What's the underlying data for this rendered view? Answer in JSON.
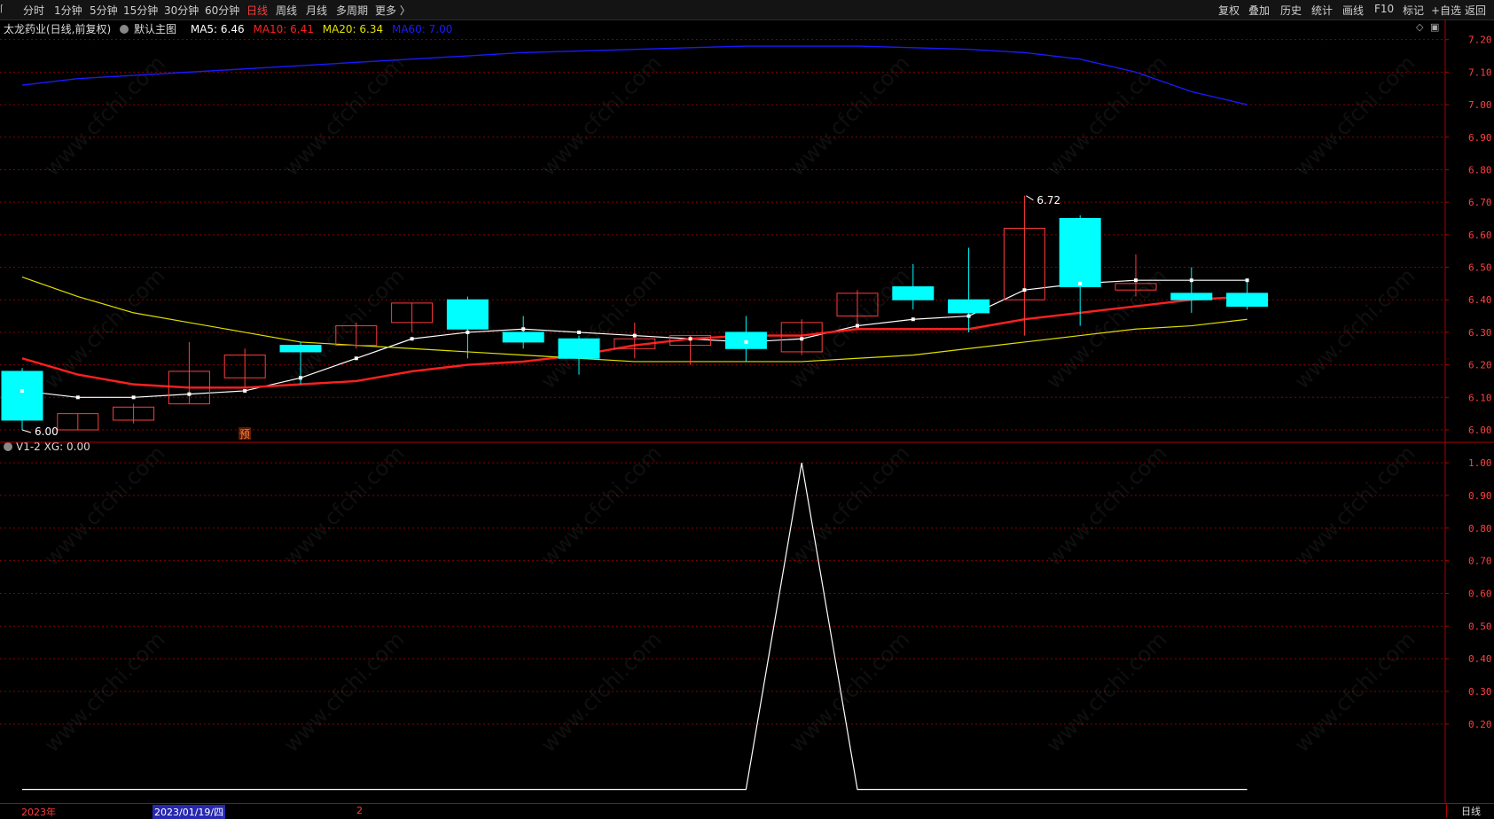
{
  "toolbar": {
    "left_items": [
      "分时",
      "1分钟",
      "5分钟",
      "15分钟",
      "30分钟",
      "60分钟",
      "日线",
      "周线",
      "月线",
      "多周期",
      "更多 〉"
    ],
    "active_item": "日线",
    "right_items": [
      "复权",
      "叠加",
      "历史",
      "统计",
      "画线",
      "F10",
      "标记",
      "+自选",
      "返回"
    ]
  },
  "main_chart": {
    "stock_label": "太龙药业(日线,前复权)",
    "indicator_name": "默认主图",
    "ma5_label": "MA5: 6.46",
    "ma10_label": "MA10: 6.41",
    "ma20_label": "MA20: 6.34",
    "ma60_label": "MA60: 7.00",
    "high_annotation": "6.72",
    "low_annotation": "6.00",
    "forecast_badge": "预",
    "y_ticks": [
      "7.20",
      "7.10",
      "7.00",
      "6.90",
      "6.80",
      "6.70",
      "6.60",
      "6.50",
      "6.40",
      "6.30",
      "6.20",
      "6.10",
      "6.00"
    ]
  },
  "sub_chart": {
    "label": "V1-2  XG: 0.00",
    "y_ticks": [
      "1.00",
      "0.90",
      "0.80",
      "0.70",
      "0.60",
      "0.50",
      "0.40",
      "0.30",
      "0.20"
    ]
  },
  "bottom_bar": {
    "year_label": "2023年",
    "date_label": "2023/01/19/四",
    "month_label": "2",
    "period": "日线"
  },
  "watermark": "www.cfchi.com",
  "colors": {
    "up": "#ff3c3c",
    "down": "#00ffff",
    "ma5": "#ffffff",
    "ma10": "#ff2020",
    "ma20": "#e0e000",
    "ma60": "#1a1aff",
    "grid": "#8a0000"
  },
  "chart_data": [
    {
      "type": "candlestick",
      "title": "太龙药业(日线,前复权)",
      "ylim": [
        6.0,
        7.2
      ],
      "candles": [
        {
          "open": 6.18,
          "close": 6.03,
          "high": 6.19,
          "low": 6.0
        },
        {
          "open": 6.0,
          "close": 6.05,
          "high": 6.05,
          "low": 6.0
        },
        {
          "open": 6.03,
          "close": 6.07,
          "high": 6.08,
          "low": 6.02
        },
        {
          "open": 6.08,
          "close": 6.18,
          "high": 6.27,
          "low": 6.08
        },
        {
          "open": 6.16,
          "close": 6.23,
          "high": 6.25,
          "low": 6.13
        },
        {
          "open": 6.26,
          "close": 6.24,
          "high": 6.27,
          "low": 6.14
        },
        {
          "open": 6.26,
          "close": 6.32,
          "high": 6.33,
          "low": 6.25
        },
        {
          "open": 6.33,
          "close": 6.39,
          "high": 6.39,
          "low": 6.3
        },
        {
          "open": 6.4,
          "close": 6.31,
          "high": 6.41,
          "low": 6.22
        },
        {
          "open": 6.3,
          "close": 6.27,
          "high": 6.35,
          "low": 6.25
        },
        {
          "open": 6.28,
          "close": 6.22,
          "high": 6.29,
          "low": 6.17
        },
        {
          "open": 6.25,
          "close": 6.28,
          "high": 6.33,
          "low": 6.22
        },
        {
          "open": 6.26,
          "close": 6.29,
          "high": 6.29,
          "low": 6.2
        },
        {
          "open": 6.3,
          "close": 6.25,
          "high": 6.35,
          "low": 6.21
        },
        {
          "open": 6.24,
          "close": 6.33,
          "high": 6.34,
          "low": 6.23
        },
        {
          "open": 6.35,
          "close": 6.42,
          "high": 6.43,
          "low": 6.31
        },
        {
          "open": 6.44,
          "close": 6.4,
          "high": 6.51,
          "low": 6.37
        },
        {
          "open": 6.4,
          "close": 6.36,
          "high": 6.56,
          "low": 6.3
        },
        {
          "open": 6.4,
          "close": 6.62,
          "high": 6.72,
          "low": 6.29
        },
        {
          "open": 6.65,
          "close": 6.44,
          "high": 6.66,
          "low": 6.32
        },
        {
          "open": 6.43,
          "close": 6.45,
          "high": 6.54,
          "low": 6.41
        },
        {
          "open": 6.42,
          "close": 6.4,
          "high": 6.5,
          "low": 6.36
        },
        {
          "open": 6.42,
          "close": 6.38,
          "high": 6.46,
          "low": 6.37
        }
      ],
      "series": [
        {
          "name": "MA5",
          "values": [
            6.12,
            6.1,
            6.1,
            6.11,
            6.12,
            6.16,
            6.22,
            6.28,
            6.3,
            6.31,
            6.3,
            6.29,
            6.28,
            6.27,
            6.28,
            6.32,
            6.34,
            6.35,
            6.43,
            6.45,
            6.46,
            6.46,
            6.46
          ]
        },
        {
          "name": "MA10",
          "values": [
            6.22,
            6.17,
            6.14,
            6.13,
            6.13,
            6.14,
            6.15,
            6.18,
            6.2,
            6.21,
            6.23,
            6.26,
            6.28,
            6.29,
            6.29,
            6.31,
            6.31,
            6.31,
            6.34,
            6.36,
            6.38,
            6.4,
            6.41
          ]
        },
        {
          "name": "MA20",
          "values": [
            6.47,
            6.41,
            6.36,
            6.33,
            6.3,
            6.27,
            6.26,
            6.25,
            6.24,
            6.23,
            6.22,
            6.21,
            6.21,
            6.21,
            6.21,
            6.22,
            6.23,
            6.25,
            6.27,
            6.29,
            6.31,
            6.32,
            6.34
          ]
        },
        {
          "name": "MA60",
          "values": [
            7.06,
            7.08,
            7.09,
            7.1,
            7.11,
            7.12,
            7.13,
            7.14,
            7.15,
            7.16,
            7.165,
            7.17,
            7.175,
            7.18,
            7.18,
            7.18,
            7.175,
            7.17,
            7.16,
            7.14,
            7.1,
            7.04,
            7.0
          ]
        }
      ]
    },
    {
      "type": "line",
      "ylim": [
        0,
        1.05
      ],
      "series": [
        {
          "name": "XG",
          "values": [
            0,
            0,
            0,
            0,
            0,
            0,
            0,
            0,
            0,
            0,
            0,
            0,
            0,
            0,
            1,
            0,
            0,
            0,
            0,
            0,
            0,
            0,
            0
          ]
        }
      ]
    }
  ]
}
